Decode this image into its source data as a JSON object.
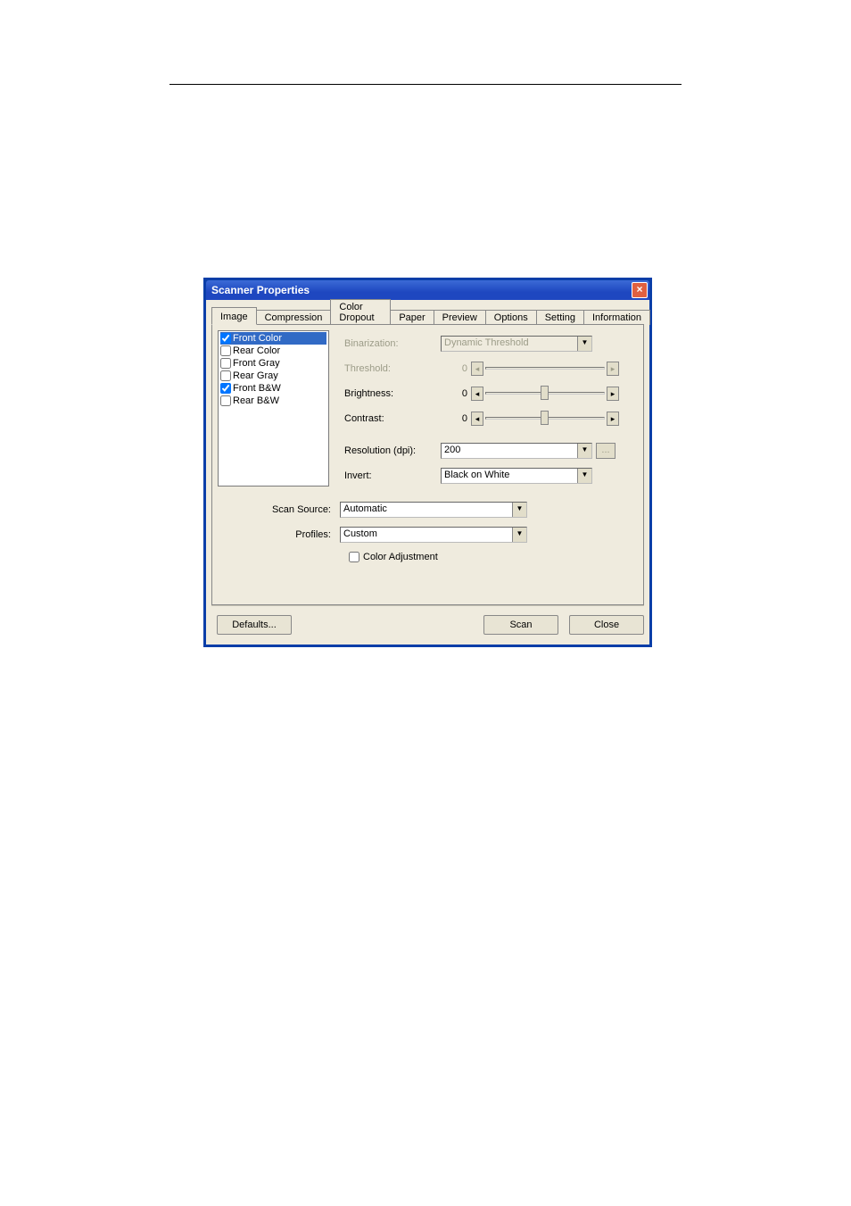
{
  "dialog": {
    "title": "Scanner Properties",
    "tabs": [
      "Image",
      "Compression",
      "Color Dropout",
      "Paper",
      "Preview",
      "Options",
      "Setting",
      "Information"
    ],
    "active_tab": 0,
    "image_modes": [
      {
        "label": "Front Color",
        "checked": true,
        "selected": true
      },
      {
        "label": "Rear Color",
        "checked": false,
        "selected": false
      },
      {
        "label": "Front Gray",
        "checked": false,
        "selected": false
      },
      {
        "label": "Rear Gray",
        "checked": false,
        "selected": false
      },
      {
        "label": "Front B&W",
        "checked": true,
        "selected": false
      },
      {
        "label": "Rear B&W",
        "checked": false,
        "selected": false
      }
    ],
    "settings": {
      "binarization_label": "Binarization:",
      "binarization_value": "Dynamic Threshold",
      "threshold_label": "Threshold:",
      "threshold_value": "0",
      "brightness_label": "Brightness:",
      "brightness_value": "0",
      "contrast_label": "Contrast:",
      "contrast_value": "0",
      "resolution_label": "Resolution (dpi):",
      "resolution_value": "200",
      "resolution_aux": "...",
      "invert_label": "Invert:",
      "invert_value": "Black on White"
    },
    "scan_source_label": "Scan Source:",
    "scan_source_value": "Automatic",
    "profiles_label": "Profiles:",
    "profiles_value": "Custom",
    "color_adjustment_label": "Color Adjustment",
    "buttons": {
      "defaults": "Defaults...",
      "scan": "Scan",
      "close": "Close"
    }
  },
  "icons": {
    "close_x": "×",
    "arrow_left": "◂",
    "arrow_right": "▸",
    "drop": "▼"
  }
}
